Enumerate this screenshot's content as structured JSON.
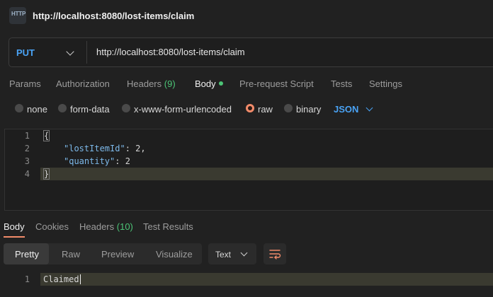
{
  "header": {
    "icon_text": "HTTP",
    "title": "http://localhost:8080/lost-items/claim"
  },
  "request": {
    "method": "PUT",
    "url": "http://localhost:8080/lost-items/claim"
  },
  "tabs": {
    "params": "Params",
    "authorization": "Authorization",
    "headers": "Headers",
    "headers_count": "(9)",
    "body": "Body",
    "prerequest": "Pre-request Script",
    "tests": "Tests",
    "settings": "Settings"
  },
  "body_types": {
    "none": "none",
    "form_data": "form-data",
    "urlencoded": "x-www-form-urlencoded",
    "raw": "raw",
    "binary": "binary",
    "format": "JSON"
  },
  "editor": {
    "line_numbers": [
      "1",
      "2",
      "3",
      "4"
    ],
    "open_brace": "{",
    "key1": "\"lostItemId\"",
    "val1": ": 2,",
    "key2": "\"quantity\"",
    "val2": ": 2",
    "close_brace": "}"
  },
  "response": {
    "tabs": {
      "body": "Body",
      "cookies": "Cookies",
      "headers": "Headers",
      "headers_count": "(10)",
      "test_results": "Test Results"
    },
    "views": {
      "pretty": "Pretty",
      "raw": "Raw",
      "preview": "Preview",
      "visualize": "Visualize"
    },
    "format": "Text",
    "line_number": "1",
    "content": "Claimed"
  },
  "colors": {
    "accent_blue": "#4aa3f5",
    "accent_orange": "#f28b6a",
    "accent_green": "#4cc476"
  }
}
